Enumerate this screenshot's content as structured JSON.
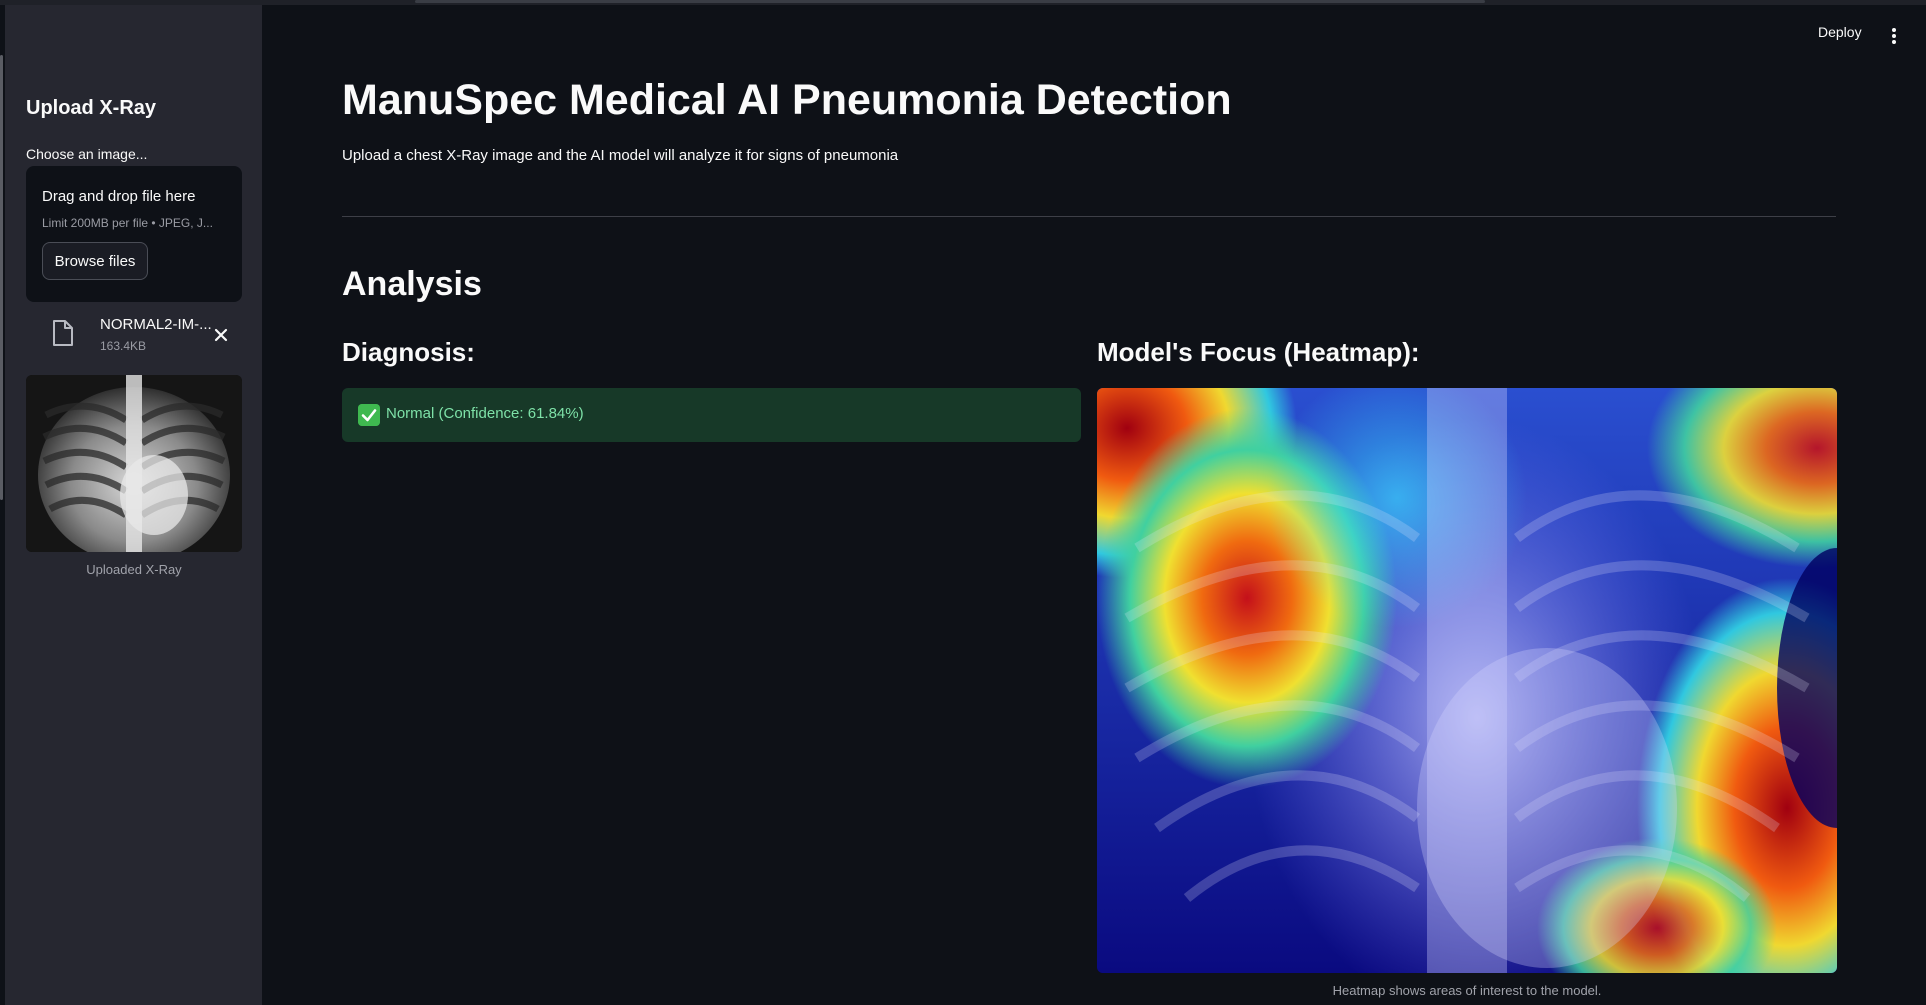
{
  "header": {
    "deploy_label": "Deploy",
    "menu_icon": "kebab-menu-icon"
  },
  "sidebar": {
    "title": "Upload X-Ray",
    "uploader_label": "Choose an image...",
    "dropzone": {
      "title": "Drag and drop file here",
      "limit": "Limit 200MB per file • JPEG, J...",
      "browse_label": "Browse files"
    },
    "file": {
      "name": "NORMAL2-IM-...",
      "size": "163.4KB",
      "icon": "file-icon",
      "remove_icon": "close-icon"
    },
    "image_caption": "Uploaded X-Ray"
  },
  "main": {
    "title": "ManuSpec Medical AI Pneumonia Detection",
    "subtitle": "Upload a chest X-Ray image and the AI model will analyze it for signs of pneumonia",
    "section_title": "Analysis",
    "diagnosis": {
      "heading": "Diagnosis:",
      "result": "Normal (Confidence: 61.84%)",
      "status_icon": "check-icon",
      "status_color": "#173928"
    },
    "heatmap": {
      "heading": "Model's Focus (Heatmap):",
      "caption": "Heatmap shows areas of interest to the model."
    }
  },
  "colors": {
    "app_bg": "#0e1117",
    "sidebar_bg": "#262730",
    "success_text": "#7ee2a8"
  }
}
